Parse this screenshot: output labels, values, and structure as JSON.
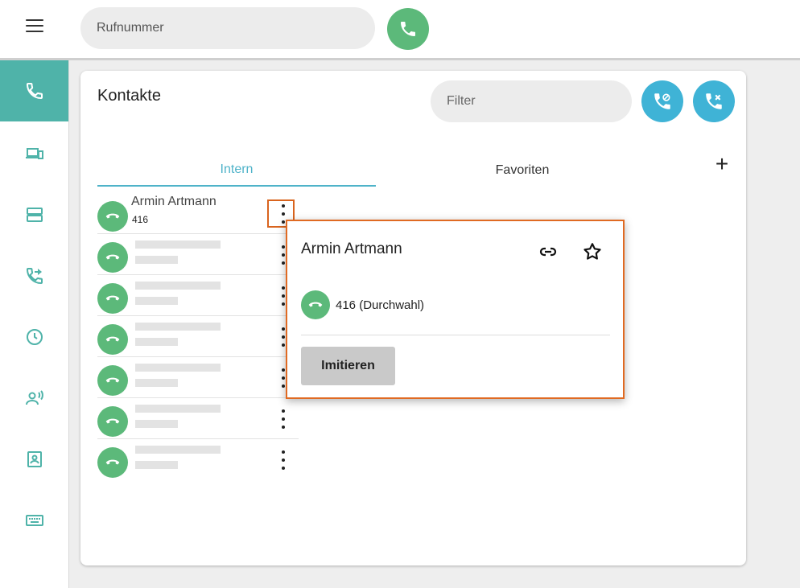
{
  "topbar": {
    "phone_placeholder": "Rufnummer"
  },
  "sidebar": {
    "items": [
      {
        "icon": "phone-icon",
        "active": true
      },
      {
        "icon": "devices-icon",
        "active": false
      },
      {
        "icon": "server-icon",
        "active": false
      },
      {
        "icon": "call-forward-icon",
        "active": false
      },
      {
        "icon": "clock-icon",
        "active": false
      },
      {
        "icon": "voicemail-person-icon",
        "active": false
      },
      {
        "icon": "contact-card-icon",
        "active": false
      },
      {
        "icon": "keyboard-icon",
        "active": false
      }
    ]
  },
  "contacts": {
    "title": "Kontakte",
    "filter_placeholder": "Filter",
    "tabs": [
      {
        "label": "Intern",
        "active": true
      },
      {
        "label": "Favoriten",
        "active": false
      }
    ],
    "list": [
      {
        "name": "Armin Artmann",
        "extension": "416"
      },
      {
        "name": "",
        "extension": ""
      },
      {
        "name": "",
        "extension": ""
      },
      {
        "name": "",
        "extension": ""
      },
      {
        "name": "",
        "extension": ""
      },
      {
        "name": "",
        "extension": ""
      },
      {
        "name": "",
        "extension": ""
      }
    ]
  },
  "popover": {
    "name": "Armin Artmann",
    "number_label": "416 (Durchwahl)",
    "action_label": "Imitieren"
  },
  "colors": {
    "accent_teal": "#4fb3a9",
    "call_green": "#5cb97a",
    "action_blue": "#3fb3d6",
    "tab_active": "#4fb3c9",
    "highlight_orange": "#e06a22"
  }
}
